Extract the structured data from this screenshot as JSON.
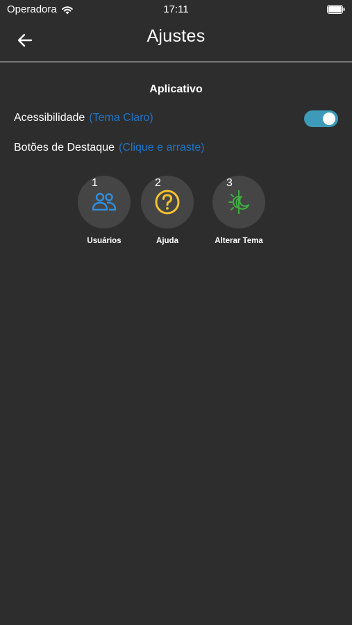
{
  "status_bar": {
    "carrier": "Operadora",
    "time": "17:11"
  },
  "nav": {
    "title": "Ajustes",
    "back_icon": "arrow-left-icon"
  },
  "section": {
    "title": "Aplicativo"
  },
  "settings": {
    "accessibility": {
      "label": "Acessibilidade",
      "hint": "(Tema Claro)",
      "toggle_on": true
    },
    "highlight_buttons": {
      "label": "Botões de Destaque",
      "hint": "(Clique e arraste)"
    }
  },
  "shortcuts": [
    {
      "number": "1",
      "label": "Usuários",
      "icon": "users-icon",
      "color": "#2f8fe0"
    },
    {
      "number": "2",
      "label": "Ajuda",
      "icon": "help-circle-icon",
      "color": "#f2c230"
    },
    {
      "number": "3",
      "label": "Alterar Tema",
      "icon": "theme-sun-moon-icon",
      "color": "#3fae3f"
    }
  ],
  "colors": {
    "background": "#2d2d2d",
    "hint": "#1e74c6",
    "toggle": "#3d9ab8"
  }
}
